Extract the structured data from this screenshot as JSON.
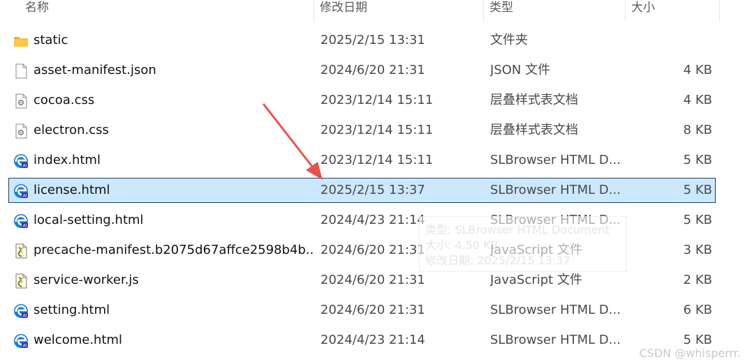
{
  "columns": {
    "name": "名称",
    "date": "修改日期",
    "type": "类型",
    "size": "大小"
  },
  "files": [
    {
      "name": "static",
      "date": "2025/2/15 13:31",
      "type": "文件夹",
      "size": "",
      "icon": "folder-icon"
    },
    {
      "name": "asset-manifest.json",
      "date": "2024/6/20 21:31",
      "type": "JSON 文件",
      "size": "4 KB",
      "icon": "file-icon"
    },
    {
      "name": "cocoa.css",
      "date": "2023/12/14 15:11",
      "type": "层叠样式表文档",
      "size": "4 KB",
      "icon": "css-file-icon"
    },
    {
      "name": "electron.css",
      "date": "2023/12/14 15:11",
      "type": "层叠样式表文档",
      "size": "8 KB",
      "icon": "css-file-icon"
    },
    {
      "name": "index.html",
      "date": "2023/12/14 15:11",
      "type": "SLBrowser HTML D...",
      "size": "5 KB",
      "icon": "browser-html-icon"
    },
    {
      "name": "license.html",
      "date": "2025/2/15 13:37",
      "type": "SLBrowser HTML D...",
      "size": "5 KB",
      "icon": "browser-html-icon",
      "selected": true
    },
    {
      "name": "local-setting.html",
      "date": "2024/4/23 21:14",
      "type": "SLBrowser HTML D...",
      "size": "5 KB",
      "icon": "browser-html-icon"
    },
    {
      "name": "precache-manifest.b2075d67affce2598b4b...",
      "date": "2024/6/20 21:31",
      "type": "JavaScript 文件",
      "size": "3 KB",
      "icon": "js-file-icon"
    },
    {
      "name": "service-worker.js",
      "date": "2024/6/20 21:31",
      "type": "JavaScript 文件",
      "size": "2 KB",
      "icon": "js-file-icon"
    },
    {
      "name": "setting.html",
      "date": "2024/6/20 21:31",
      "type": "SLBrowser HTML D...",
      "size": "6 KB",
      "icon": "browser-html-icon"
    },
    {
      "name": "welcome.html",
      "date": "2024/4/23 21:14",
      "type": "SLBrowser HTML D...",
      "size": "5 KB",
      "icon": "browser-html-icon"
    }
  ],
  "tooltip": {
    "type_line": "类型: SLBrowser HTML Document",
    "size_line": "大小: 4.50 KB",
    "date_line": "修改日期: 2025/2/15 13:37"
  },
  "watermark": "CSDN @whisperrr.",
  "colors": {
    "selection_bg": "#cce8ff",
    "selection_border": "#1f3d5c",
    "arrow": "#e8534a",
    "folder": "#f8c846",
    "browser_icon": "#1a7fd8"
  }
}
